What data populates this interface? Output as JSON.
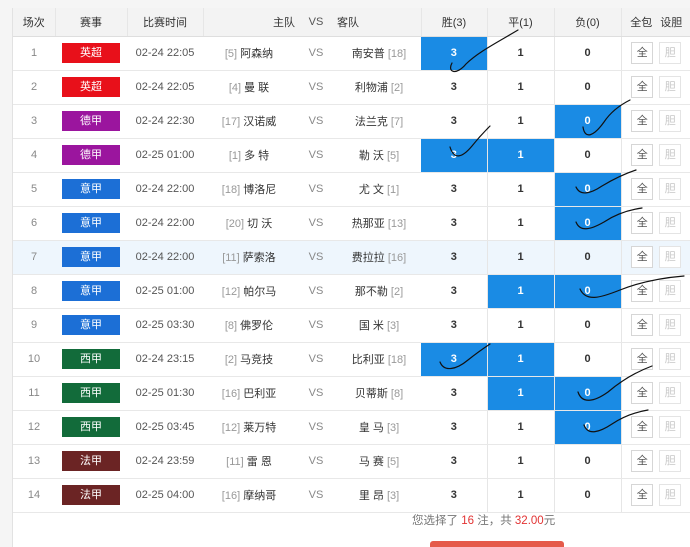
{
  "headers": {
    "index": "场次",
    "league": "赛事",
    "time": "比赛时间",
    "home": "主队",
    "vs": "VS",
    "away": "客队",
    "win": "胜(3)",
    "draw": "平(1)",
    "lose": "负(0)",
    "allin": "全包",
    "setbile": "设胆"
  },
  "button_labels": {
    "all": "全",
    "bile": "胆"
  },
  "league_colors": {
    "英超": "#e8101a",
    "德甲": "#9b159e",
    "意甲": "#1c6fd6",
    "西甲": "#126b3a",
    "法甲": "#6b2424"
  },
  "selected_color": "#1a8be4",
  "rows": [
    {
      "idx": "1",
      "league": "英超",
      "time": "02-24 22:05",
      "home_rank": "[5]",
      "home": "阿森纳",
      "vs": "VS",
      "away": "南安普",
      "away_rank": "[18]",
      "win": "3",
      "draw": "1",
      "lose": "0",
      "selected": [
        "win"
      ]
    },
    {
      "idx": "2",
      "league": "英超",
      "time": "02-24 22:05",
      "home_rank": "[4]",
      "home": "曼 联",
      "vs": "VS",
      "away": "利物浦",
      "away_rank": "[2]",
      "win": "3",
      "draw": "1",
      "lose": "0",
      "selected": []
    },
    {
      "idx": "3",
      "league": "德甲",
      "time": "02-24 22:30",
      "home_rank": "[17]",
      "home": "汉诺威",
      "vs": "VS",
      "away": "法兰克",
      "away_rank": "[7]",
      "win": "3",
      "draw": "1",
      "lose": "0",
      "selected": [
        "lose"
      ]
    },
    {
      "idx": "4",
      "league": "德甲",
      "time": "02-25 01:00",
      "home_rank": "[1]",
      "home": "多 特",
      "vs": "VS",
      "away": "勒 沃",
      "away_rank": "[5]",
      "win": "3",
      "draw": "1",
      "lose": "0",
      "selected": [
        "win",
        "draw"
      ]
    },
    {
      "idx": "5",
      "league": "意甲",
      "time": "02-24 22:00",
      "home_rank": "[18]",
      "home": "博洛尼",
      "vs": "VS",
      "away": "尤 文",
      "away_rank": "[1]",
      "win": "3",
      "draw": "1",
      "lose": "0",
      "selected": [
        "lose"
      ]
    },
    {
      "idx": "6",
      "league": "意甲",
      "time": "02-24 22:00",
      "home_rank": "[20]",
      "home": "切 沃",
      "vs": "VS",
      "away": "热那亚",
      "away_rank": "[13]",
      "win": "3",
      "draw": "1",
      "lose": "0",
      "selected": [
        "lose"
      ]
    },
    {
      "idx": "7",
      "league": "意甲",
      "time": "02-24 22:00",
      "home_rank": "[11]",
      "home": "萨索洛",
      "vs": "VS",
      "away": "费拉拉",
      "away_rank": "[16]",
      "win": "3",
      "draw": "1",
      "lose": "0",
      "selected": [],
      "highlight": true
    },
    {
      "idx": "8",
      "league": "意甲",
      "time": "02-25 01:00",
      "home_rank": "[12]",
      "home": "帕尔马",
      "vs": "VS",
      "away": "那不勒",
      "away_rank": "[2]",
      "win": "3",
      "draw": "1",
      "lose": "0",
      "selected": [
        "draw",
        "lose"
      ]
    },
    {
      "idx": "9",
      "league": "意甲",
      "time": "02-25 03:30",
      "home_rank": "[8]",
      "home": "佛罗伦",
      "vs": "VS",
      "away": "国 米",
      "away_rank": "[3]",
      "win": "3",
      "draw": "1",
      "lose": "0",
      "selected": []
    },
    {
      "idx": "10",
      "league": "西甲",
      "time": "02-24 23:15",
      "home_rank": "[2]",
      "home": "马竞技",
      "vs": "VS",
      "away": "比利亚",
      "away_rank": "[18]",
      "win": "3",
      "draw": "1",
      "lose": "0",
      "selected": [
        "win",
        "draw"
      ]
    },
    {
      "idx": "11",
      "league": "西甲",
      "time": "02-25 01:30",
      "home_rank": "[16]",
      "home": "巴利亚",
      "vs": "VS",
      "away": "贝蒂斯",
      "away_rank": "[8]",
      "win": "3",
      "draw": "1",
      "lose": "0",
      "selected": [
        "draw",
        "lose"
      ]
    },
    {
      "idx": "12",
      "league": "西甲",
      "time": "02-25 03:45",
      "home_rank": "[12]",
      "home": "莱万特",
      "vs": "VS",
      "away": "皇 马",
      "away_rank": "[3]",
      "win": "3",
      "draw": "1",
      "lose": "0",
      "selected": [
        "lose"
      ]
    },
    {
      "idx": "13",
      "league": "法甲",
      "time": "02-24 23:59",
      "home_rank": "[11]",
      "home": "雷 恩",
      "vs": "VS",
      "away": "马 赛",
      "away_rank": "[5]",
      "win": "3",
      "draw": "1",
      "lose": "0",
      "selected": []
    },
    {
      "idx": "14",
      "league": "法甲",
      "time": "02-25 04:00",
      "home_rank": "[16]",
      "home": "摩纳哥",
      "vs": "VS",
      "away": "里 昂",
      "away_rank": "[3]",
      "win": "3",
      "draw": "1",
      "lose": "0",
      "selected": []
    }
  ],
  "summary": {
    "prefix": "您选择了",
    "count": "16",
    "mid": "注，共",
    "amount": "32.00",
    "suffix": "元"
  }
}
